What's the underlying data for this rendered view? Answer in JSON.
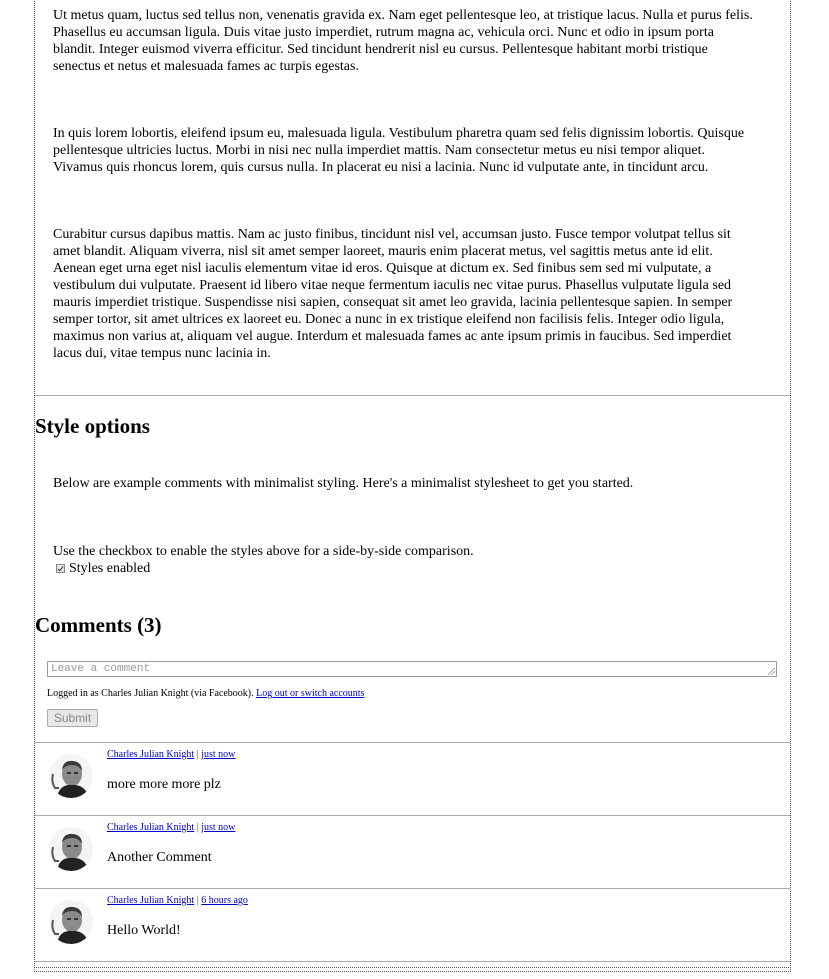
{
  "intro": {
    "paragraphs": [
      "Ut metus quam, luctus sed tellus non, venenatis gravida ex. Nam eget pellentesque leo, at tristique lacus. Nulla et purus felis. Phasellus eu accumsan ligula. Duis vitae justo imperdiet, rutrum magna ac, vehicula orci. Nunc et odio in ipsum porta blandit. Integer euismod viverra efficitur. Sed tincidunt hendrerit nisl eu cursus. Pellentesque habitant morbi tristique senectus et netus et malesuada fames ac turpis egestas.",
      "In quis lorem lobortis, eleifend ipsum eu, malesuada ligula. Vestibulum pharetra quam sed felis dignissim lobortis. Quisque pellentesque ultricies luctus. Morbi in nisi nec nulla imperdiet mattis. Nam consectetur metus eu nisi tempor aliquet. Vivamus quis rhoncus lorem, quis cursus nulla. In placerat eu nisi a lacinia. Nunc id vulputate ante, in tincidunt arcu.",
      "Curabitur cursus dapibus mattis. Nam ac justo finibus, tincidunt nisl vel, accumsan justo. Fusce tempor volutpat tellus sit amet blandit. Aliquam viverra, nisl sit amet semper laoreet, mauris enim placerat metus, vel sagittis metus ante id elit. Aenean eget urna eget nisl iaculis elementum vitae id eros. Quisque at dictum ex. Sed finibus sem sed mi vulputate, a vestibulum dui vulputate. Praesent id libero vitae neque fermentum iaculis nec vitae purus. Phasellus vulputate ligula sed mauris imperdiet tristique. Suspendisse nisi sapien, consequat sit amet leo gravida, lacinia pellentesque sapien. In semper semper tortor, sit amet ultrices ex laoreet eu. Donec a nunc in ex tristique eleifend non facilisis felis. Integer odio ligula, maximus non varius at, aliquam vel augue. Interdum et malesuada fames ac ante ipsum primis in faucibus. Sed imperdiet lacus dui, vitae tempus nunc lacinia in."
    ]
  },
  "style_options": {
    "heading": "Style options",
    "description": "Below are example comments with minimalist styling. Here's a minimalist stylesheet to get you started.",
    "checkbox_hint": "Use the checkbox to enable the styles above for a side-by-side comparison.",
    "checkbox_label": "Styles enabled",
    "checkbox_checked": true
  },
  "comments_section": {
    "heading": "Comments (3)",
    "input_placeholder": "Leave a comment",
    "logged_in_text": "Logged in as Charles Julian Knight (via Facebook).",
    "logout_link": "Log out or switch accounts",
    "submit_label": "Submit",
    "separator": "|",
    "comments": [
      {
        "author": "Charles Julian Knight",
        "time": "just now",
        "text": "more more more plz"
      },
      {
        "author": "Charles Julian Knight",
        "time": "just now",
        "text": "Another Comment"
      },
      {
        "author": "Charles Julian Knight",
        "time": "6 hours ago",
        "text": "Hello World!"
      }
    ]
  }
}
